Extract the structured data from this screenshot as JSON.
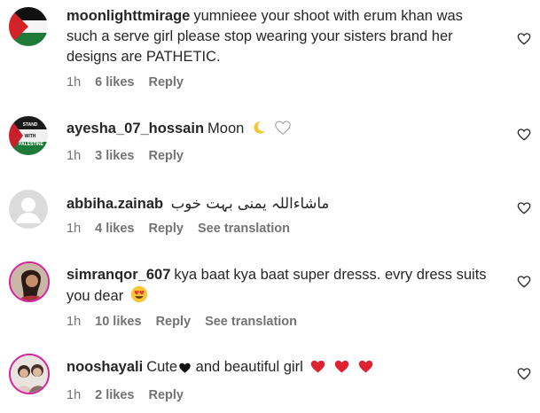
{
  "comments": [
    {
      "username": "moonlighttmirage",
      "text": "yumnieee your shoot with erum khan was such a serve girl please stop wearing your sisters brand her designs are PATHETIC.",
      "time": "1h",
      "likes": "6 likes",
      "reply": "Reply"
    },
    {
      "username": "ayesha_07_hossain",
      "text": "Moon",
      "emojis": [
        "crescent-moon",
        "white-heart"
      ],
      "time": "1h",
      "likes": "3 likes",
      "reply": "Reply",
      "avatar_text": "STAND WITH PALESTINE"
    },
    {
      "username": "abbiha.zainab",
      "text": "ماشاءاللہ یمنی بہت خوب",
      "time": "1h",
      "likes": "4 likes",
      "reply": "Reply",
      "translation": "See translation"
    },
    {
      "username": "simranqor_607",
      "text": "kya baat kya baat super dresss. evry dress suits you dear",
      "emojis": [
        "heart-eyes"
      ],
      "time": "1h",
      "likes": "10 likes",
      "reply": "Reply",
      "translation": "See translation"
    },
    {
      "username": "nooshayali",
      "text_before": "Cute",
      "text_after": "and beautiful girl",
      "emojis": [
        "black-heart",
        "red-heart",
        "red-heart",
        "red-heart"
      ],
      "time": "1h",
      "likes": "2 likes",
      "reply": "Reply"
    }
  ],
  "colors": {
    "text": "#262626",
    "meta": "#737373",
    "red_heart": "#e0222f"
  }
}
